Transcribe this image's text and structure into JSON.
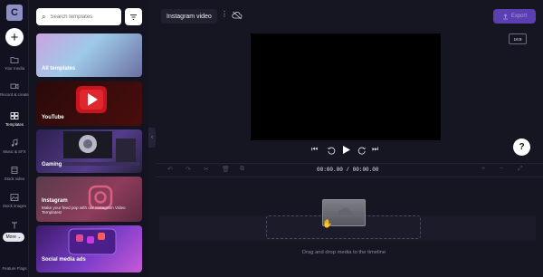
{
  "rail": {
    "logo_letter": "C",
    "items": [
      {
        "label": "Your media",
        "icon": "folder-icon"
      },
      {
        "label": "Record & create",
        "icon": "video-camera-icon"
      },
      {
        "label": "Templates",
        "icon": "templates-grid-icon"
      },
      {
        "label": "Music & SFX",
        "icon": "music-note-icon"
      },
      {
        "label": "Stock video",
        "icon": "film-icon"
      },
      {
        "label": "Stock images",
        "icon": "image-icon"
      },
      {
        "label": "Text",
        "icon": "text-icon"
      }
    ],
    "more_label": "More",
    "bottom_label": "Feature Flags"
  },
  "templates": {
    "search_placeholder": "Search templates",
    "cards": [
      {
        "title": "All templates",
        "subtitle": ""
      },
      {
        "title": "YouTube",
        "subtitle": ""
      },
      {
        "title": "Gaming",
        "subtitle": ""
      },
      {
        "title": "Instagram",
        "subtitle": "Make your feed pop with our Instagram Video Templates!"
      },
      {
        "title": "Social media ads",
        "subtitle": ""
      }
    ]
  },
  "header": {
    "project_title": "Instagram video",
    "export_label": "Export"
  },
  "stage": {
    "aspect_ratio": "16:9"
  },
  "timeline": {
    "current_time": "00:00.00",
    "separator": "/",
    "total_time": "00:00.00",
    "drop_hint": "Drag and drop media to the timeline"
  },
  "colors": {
    "accent": "#5a3fb0",
    "background": "#161623"
  }
}
